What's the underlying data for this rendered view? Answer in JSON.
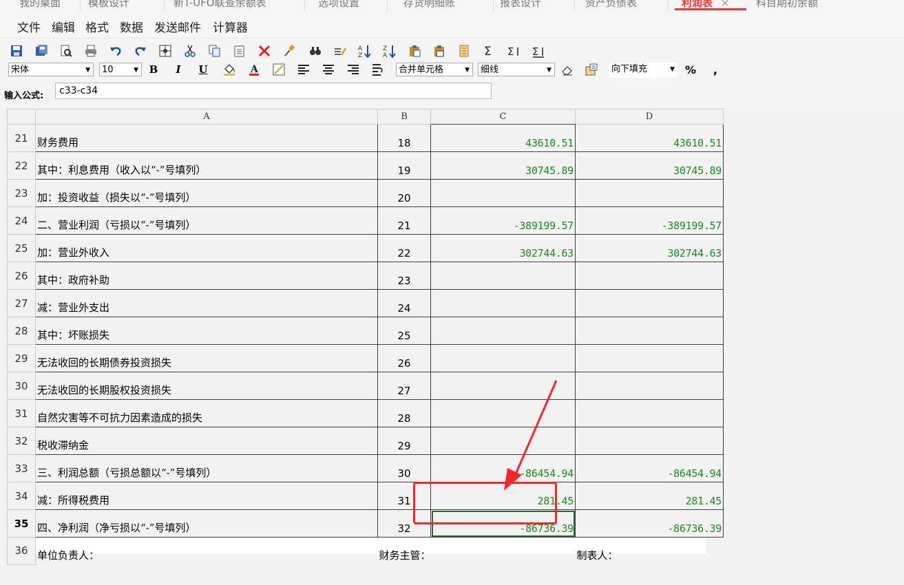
{
  "tabs": [
    {
      "label": "我的桌面",
      "active": false
    },
    {
      "label": "模板设计",
      "active": false
    },
    {
      "label": "新T-UFO联查余额表",
      "active": false
    },
    {
      "label": "选项设置",
      "active": false
    },
    {
      "label": "存货明细账",
      "active": false
    },
    {
      "label": "报表设计",
      "active": false
    },
    {
      "label": "资产负债表",
      "active": false
    },
    {
      "label": "利润表",
      "active": true
    },
    {
      "label": "科目期初余额",
      "active": false
    }
  ],
  "tab_close": "×",
  "menu": [
    "文件",
    "编辑",
    "格式",
    "数据",
    "发送邮件",
    "计算器"
  ],
  "toolbar": {
    "font_name": "宋体",
    "font_size": "10",
    "merge": "合并单元格",
    "line": "细线",
    "fill": "向下填充",
    "bold": "B",
    "italic": "I",
    "underline": "U",
    "percent": "%",
    "comma": ","
  },
  "formula": {
    "label": "输入公式:",
    "value": "c33-c34"
  },
  "columns": [
    "A",
    "B",
    "C",
    "D"
  ],
  "rows": [
    {
      "n": "21",
      "a": "财务费用",
      "b": "18",
      "c": "43610.51",
      "d": "43610.51"
    },
    {
      "n": "22",
      "a": "   其中：利息费用（收入以“-”号填列）",
      "b": "19",
      "c": "30745.89",
      "d": "30745.89"
    },
    {
      "n": "23",
      "a": "加：投资收益（损失以“-”号填列）",
      "b": "20",
      "c": "",
      "d": ""
    },
    {
      "n": "24",
      "a": "二、营业利润（亏损以“-”号填列）",
      "b": "21",
      "c": "-389199.57",
      "d": "-389199.57"
    },
    {
      "n": "25",
      "a": "加：营业外收入",
      "b": "22",
      "c": "302744.63",
      "d": "302744.63"
    },
    {
      "n": "26",
      "a": "   其中：政府补助",
      "b": "23",
      "c": "",
      "d": ""
    },
    {
      "n": "27",
      "a": "减：营业外支出",
      "b": "24",
      "c": "",
      "d": ""
    },
    {
      "n": "28",
      "a": "其中：坏账损失",
      "b": "25",
      "c": "",
      "d": ""
    },
    {
      "n": "29",
      "a": "        无法收回的长期债券投资损失",
      "b": "26",
      "c": "",
      "d": ""
    },
    {
      "n": "30",
      "a": "        无法收回的长期股权投资损失",
      "b": "27",
      "c": "",
      "d": ""
    },
    {
      "n": "31",
      "a": "        自然灾害等不可抗力因素造成的损失",
      "b": "28",
      "c": "",
      "d": ""
    },
    {
      "n": "32",
      "a": "        税收滞纳金",
      "b": "29",
      "c": "",
      "d": ""
    },
    {
      "n": "33",
      "a": "三、利润总额（亏损总额以“-”号填列）",
      "b": "30",
      "c": "-86454.94",
      "d": "-86454.94"
    },
    {
      "n": "34",
      "a": "减：所得税费用",
      "b": "31",
      "c": "281.45",
      "d": "281.45"
    },
    {
      "n": "35",
      "a": "四、净利润（净亏损以“-”号填列）",
      "b": "32",
      "c": "-86736.39",
      "d": "-86736.39"
    }
  ],
  "footer": {
    "n": "36",
    "a": "单位负责人：",
    "b": "财务主管：",
    "d": "制表人："
  },
  "selected_row": "35",
  "colors": {
    "number": "#1c8a1c",
    "callout": "#f02828",
    "active_tab": "#e33333"
  }
}
